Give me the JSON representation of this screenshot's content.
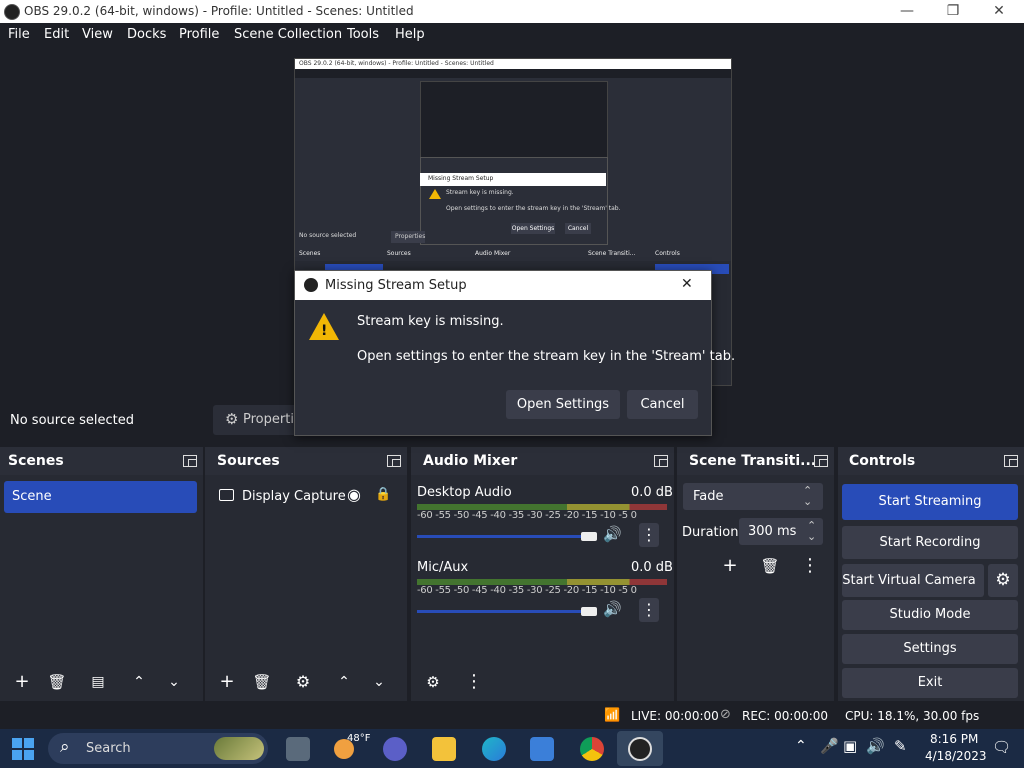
{
  "window": {
    "title": "OBS 29.0.2 (64-bit, windows) - Profile: Untitled - Scenes: Untitled",
    "minimize": "—",
    "maximize": "❐",
    "close": "✕"
  },
  "menu": [
    "File",
    "Edit",
    "View",
    "Docks",
    "Profile",
    "Scene Collection",
    "Tools",
    "Help"
  ],
  "preview": {
    "nested_title": "OBS 29.0.2 (64-bit, windows) - Profile: Untitled - Scenes: Untitled",
    "nested_no_source": "No source selected",
    "nested_properties": "Properties",
    "nested_docks": [
      "Scenes",
      "Sources",
      "Audio Mixer",
      "Scene Transiti...",
      "Controls"
    ],
    "nested_dialog_title": "Missing Stream Setup",
    "nested_msg1": "Stream key is missing.",
    "nested_msg2": "Open settings to enter the stream key in the 'Stream' tab.",
    "nested_open": "Open Settings",
    "nested_cancel": "Cancel"
  },
  "source_bar": {
    "no_source": "No source selected",
    "properties": "Properties"
  },
  "dialog": {
    "title": "Missing Stream Setup",
    "close": "✕",
    "message": "Stream key is missing.",
    "detail": "Open settings to enter the stream key in the 'Stream' tab.",
    "open_settings": "Open Settings",
    "cancel": "Cancel"
  },
  "scenes": {
    "title": "Scenes",
    "items": [
      "Scene"
    ]
  },
  "sources": {
    "title": "Sources",
    "items": [
      {
        "label": "Display Capture",
        "visible": true,
        "locked": false
      }
    ]
  },
  "audio": {
    "title": "Audio Mixer",
    "ticks": "-60 -55 -50 -45 -40 -35 -30 -25 -20 -15 -10 -5  0",
    "channels": [
      {
        "name": "Desktop Audio",
        "db": "0.0 dB",
        "volume": 1.0
      },
      {
        "name": "Mic/Aux",
        "db": "0.0 dB",
        "volume": 1.0
      }
    ]
  },
  "transitions": {
    "title": "Scene Transiti...",
    "selected": "Fade",
    "duration_label": "Duration",
    "duration_value": "300 ms"
  },
  "controls": {
    "title": "Controls",
    "start_streaming": "Start Streaming",
    "start_recording": "Start Recording",
    "start_virtual_camera": "Start Virtual Camera",
    "studio_mode": "Studio Mode",
    "settings": "Settings",
    "exit": "Exit"
  },
  "status": {
    "live": "LIVE: 00:00:00",
    "rec": "REC: 00:00:00",
    "cpu": "CPU: 18.1%, 30.00 fps"
  },
  "taskbar": {
    "search": "Search",
    "weather": "48°F",
    "time": "8:16 PM",
    "date": "4/18/2023"
  },
  "colors": {
    "accent": "#284cb8",
    "panel": "#272a33",
    "background": "#1d1f26"
  }
}
